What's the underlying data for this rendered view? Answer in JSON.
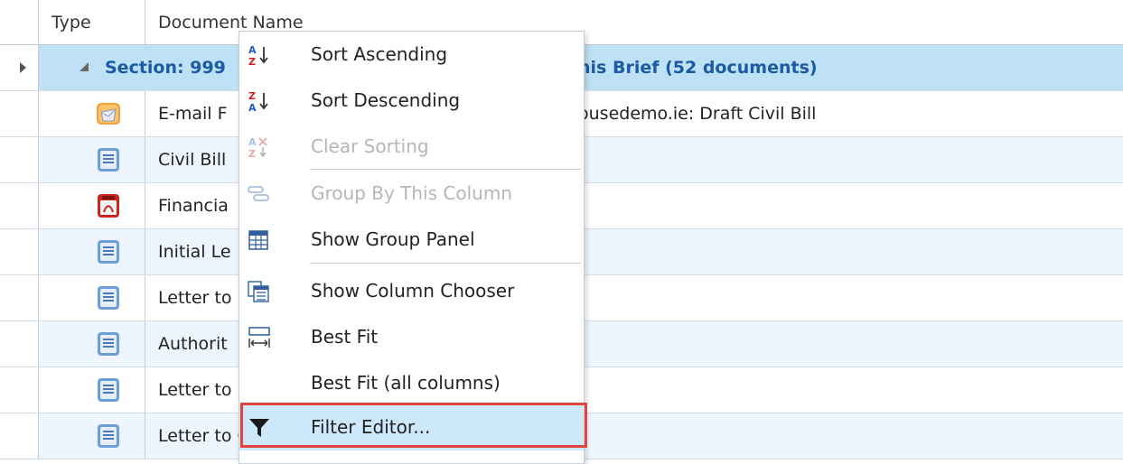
{
  "grid": {
    "columns": [
      "Type",
      "Document Name"
    ],
    "group_row": {
      "label_left": "Section: 999",
      "label_right": "his Brief (52 documents)"
    },
    "rows": [
      {
        "icon": "email-icon",
        "name": "E-mail F",
        "name_right": "ousedemo.ie: Draft Civil Bill"
      },
      {
        "icon": "word-doc-icon",
        "name": "Civil Bill"
      },
      {
        "icon": "pdf-icon",
        "name": "Financia"
      },
      {
        "icon": "word-doc-icon",
        "name": "Initial Le"
      },
      {
        "icon": "word-doc-icon",
        "name": "Letter to"
      },
      {
        "icon": "word-doc-icon",
        "name": "Authorit"
      },
      {
        "icon": "word-doc-icon",
        "name": "Letter to"
      },
      {
        "icon": "word-doc-icon",
        "name": "Letter to Garda"
      }
    ]
  },
  "context_menu": {
    "items": [
      {
        "label": "Sort Ascending",
        "icon": "sort-ascending-icon",
        "enabled": true
      },
      {
        "label": "Sort Descending",
        "icon": "sort-descending-icon",
        "enabled": true
      },
      {
        "label": "Clear Sorting",
        "icon": "clear-sorting-icon",
        "enabled": false
      },
      {
        "label": "Group By This Column",
        "icon": "group-by-icon",
        "enabled": false
      },
      {
        "label": "Show Group Panel",
        "icon": "group-panel-icon",
        "enabled": true
      },
      {
        "label": "Show Column Chooser",
        "icon": "column-chooser-icon",
        "enabled": true
      },
      {
        "label": "Best Fit",
        "icon": "best-fit-icon",
        "enabled": true
      },
      {
        "label": "Best Fit (all columns)",
        "icon": "",
        "enabled": true
      },
      {
        "label": "Filter Editor...",
        "icon": "filter-icon",
        "enabled": true,
        "highlighted": true
      }
    ]
  },
  "colors": {
    "group_row_bg": "#bfe1f6",
    "group_text": "#1d5aa6",
    "highlight_bg": "#cde8fb",
    "annotation_border": "#e0443f"
  }
}
